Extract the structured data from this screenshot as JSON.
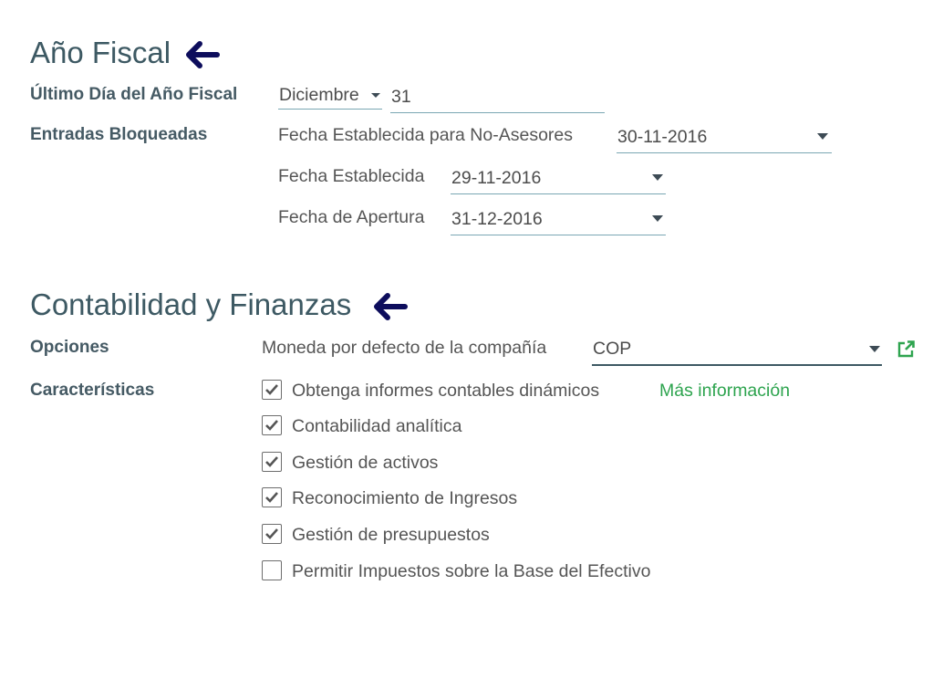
{
  "fiscal_year": {
    "title": "Año Fiscal",
    "last_day_label": "Último Día del Año Fiscal",
    "month_value": "Diciembre",
    "day_value": "31",
    "locked_entries_label": "Entradas Bloqueadas",
    "non_advisor_lock_label": "Fecha Establecida para No-Asesores",
    "non_advisor_lock_value": "30-11-2016",
    "lock_date_label": "Fecha Establecida",
    "lock_date_value": "29-11-2016",
    "opening_date_label": "Fecha de Apertura",
    "opening_date_value": "31-12-2016"
  },
  "accounting": {
    "title": "Contabilidad y Finanzas",
    "options_label": "Opciones",
    "currency_label": "Moneda por defecto de la compañía",
    "currency_value": "COP",
    "features_label": "Características",
    "more_info_link": "Más información",
    "features": [
      {
        "label": "Obtenga informes contables dinámicos",
        "checked": true
      },
      {
        "label": "Contabilidad analítica",
        "checked": true
      },
      {
        "label": "Gestión de activos",
        "checked": true
      },
      {
        "label": "Reconocimiento de Ingresos",
        "checked": true
      },
      {
        "label": "Gestión de presupuestos",
        "checked": true
      },
      {
        "label": "Permitir Impuestos sobre la Base del Efectivo",
        "checked": false
      }
    ]
  },
  "colors": {
    "title": "#3d5963",
    "arrow": "#0d0d5c",
    "field_underline": "#7aa7b3",
    "link": "#2ea44f"
  },
  "icons": {
    "annotation_arrow": "arrow-left-icon",
    "dropdown": "caret-down-icon",
    "external_link": "external-link-icon",
    "check": "checkmark-icon"
  }
}
